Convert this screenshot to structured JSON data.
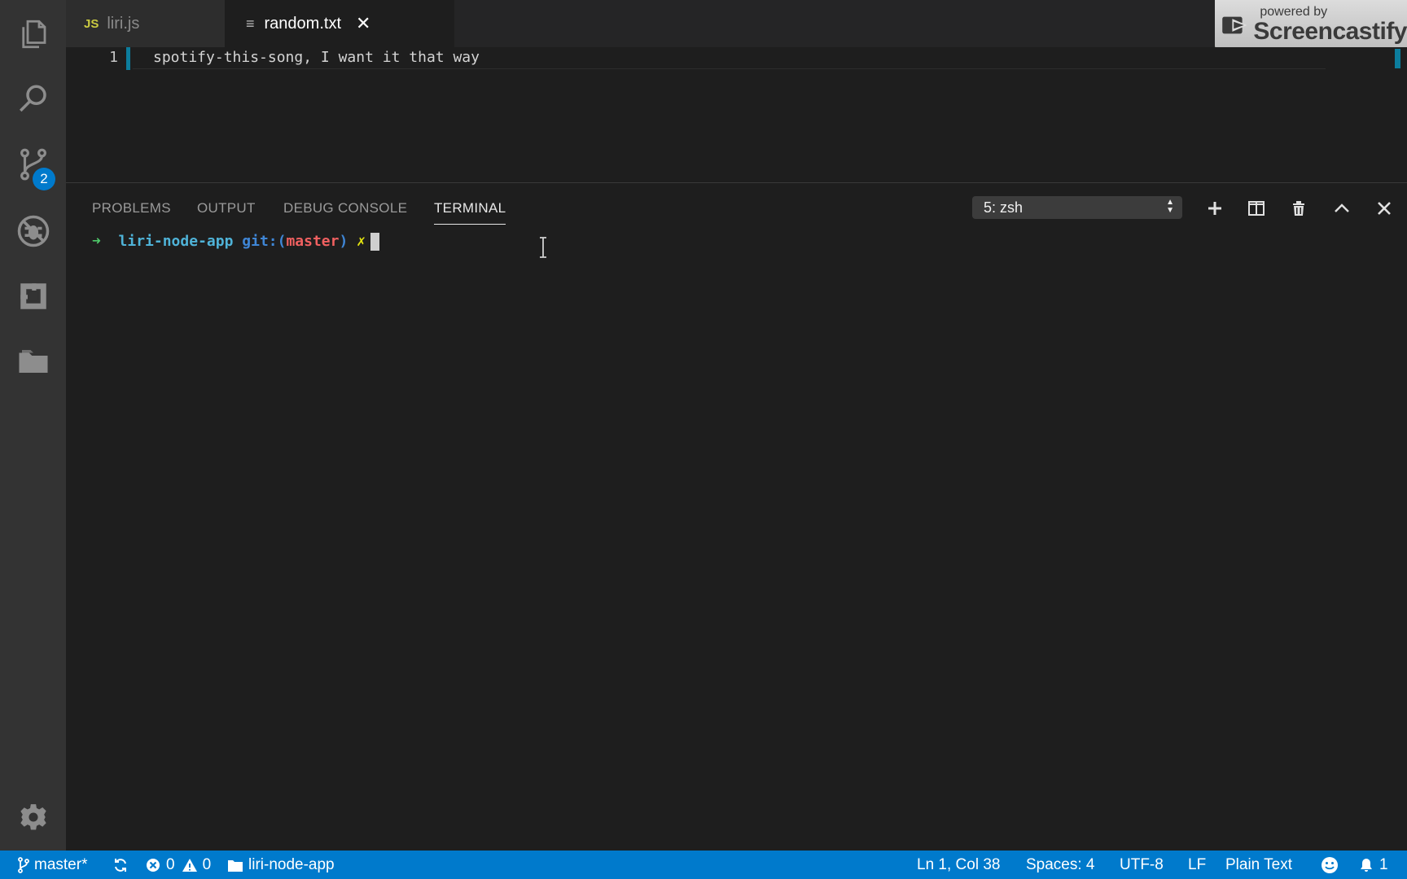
{
  "tabs": [
    {
      "label": "liri.js",
      "type_badge": "JS",
      "active": false
    },
    {
      "label": "random.txt",
      "active": true
    }
  ],
  "watermark": {
    "line1": "powered by",
    "line2": "Screencastify"
  },
  "editor": {
    "line_number": "1",
    "line_text": "spotify-this-song, I want it that way"
  },
  "activity_bar": {
    "scm_badge": "2",
    "icons": [
      "explorer-icon",
      "search-icon",
      "source-control-icon",
      "debug-icon",
      "extensions-icon",
      "folder-icon",
      "gear-icon"
    ]
  },
  "panel": {
    "tabs": [
      "PROBLEMS",
      "OUTPUT",
      "DEBUG CONSOLE",
      "TERMINAL"
    ],
    "active_tab": "TERMINAL",
    "terminal_select": "5: zsh"
  },
  "terminal": {
    "arrow": "➜",
    "dir": "liri-node-app",
    "git_prefix": "git:(",
    "branch": "master",
    "git_suffix": ")",
    "dirty": "✗"
  },
  "statusbar": {
    "branch": "master*",
    "errors": "0",
    "warnings": "0",
    "folder": "liri-node-app",
    "position": "Ln 1, Col 38",
    "spaces": "Spaces: 4",
    "encoding": "UTF-8",
    "eol": "LF",
    "language": "Plain Text",
    "notifications": "1"
  },
  "colors": {
    "accent": "#007acc",
    "activity_bar": "#333333",
    "editor_bg": "#1e1e1e",
    "line_marker": "#0c7d9d"
  }
}
